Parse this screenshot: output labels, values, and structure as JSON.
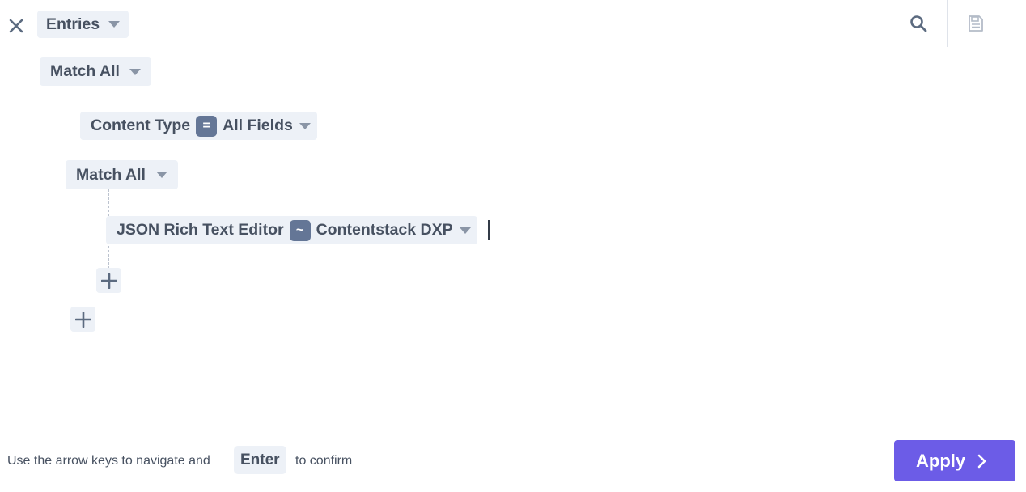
{
  "toolbar": {
    "close_icon": "close-icon",
    "scope_label": "Entries",
    "search_icon": "search-icon",
    "save_icon": "save-icon"
  },
  "query": {
    "root_group": {
      "label": "Match All"
    },
    "condition_1": {
      "field": "Content Type",
      "operator": "=",
      "value": "All Fields"
    },
    "nested_group": {
      "label": "Match All"
    },
    "condition_2": {
      "field": "JSON Rich Text Editor",
      "operator": "~",
      "value": "Contentstack DXP"
    },
    "add_icon": "plus-icon"
  },
  "footer": {
    "hint_prefix": "Use the arrow keys to navigate and",
    "key": "Enter",
    "hint_suffix": "to confirm",
    "apply_label": "Apply"
  },
  "colors": {
    "accent": "#6c5ce7",
    "chip_bg": "#edf1f7",
    "operator_bg": "#647696",
    "text": "#475161"
  }
}
